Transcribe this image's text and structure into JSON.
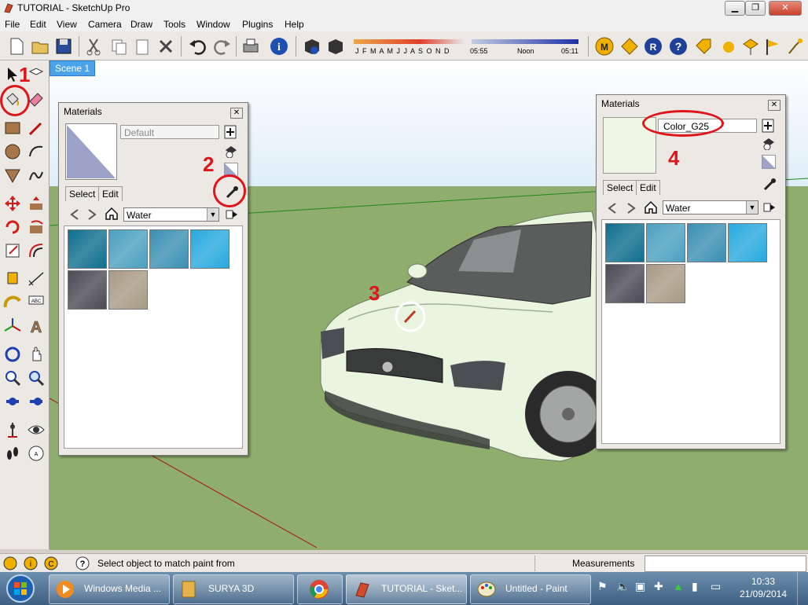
{
  "window": {
    "title": "TUTORIAL - SketchUp Pro"
  },
  "menu": [
    "File",
    "Edit",
    "View",
    "Camera",
    "Draw",
    "Tools",
    "Window",
    "Plugins",
    "Help"
  ],
  "shadow_bar": {
    "months": "J F M A M J J A S O N D",
    "time_start": "05:55",
    "time_noon": "Noon",
    "time_end": "05:11"
  },
  "scene_tab": "Scene 1",
  "materials_left": {
    "title": "Materials",
    "name_value": "Default",
    "tabs": [
      "Select",
      "Edit"
    ],
    "library": "Water",
    "swatch_colors": [
      "#0f6e8e",
      "#4aa0c0",
      "#3a8fb3",
      "#27a9de",
      "#4b4a55",
      "#a89b84"
    ]
  },
  "materials_right": {
    "title": "Materials",
    "name_value": "Color_G25",
    "preview_color": "#eef7e6",
    "tabs": [
      "Select",
      "Edit"
    ],
    "library": "Water",
    "swatch_colors": [
      "#0f6e8e",
      "#4aa0c0",
      "#3a8fb3",
      "#27a9de",
      "#4b4a55",
      "#a89b84"
    ]
  },
  "annotations": {
    "n1": "1",
    "n2": "2",
    "n3": "3",
    "n4": "4"
  },
  "status": {
    "message": "Select object to match paint from",
    "measurements_label": "Measurements"
  },
  "taskbar": {
    "items": [
      "Windows Media ...",
      "SURYA 3D",
      "",
      "TUTORIAL - Sket...",
      "Untitled - Paint"
    ],
    "time": "10:33",
    "date": "21/09/2014"
  },
  "colors": {
    "accent_red": "#e0151b",
    "ground": "#8fae6e",
    "car_body": "#e9f5df"
  }
}
